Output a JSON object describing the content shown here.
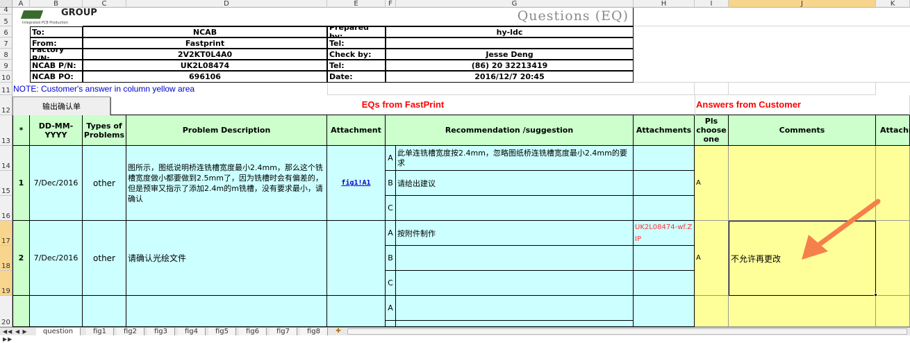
{
  "columns": [
    "A",
    "B",
    "C",
    "D",
    "E",
    "F",
    "G",
    "H",
    "I",
    "J",
    "K"
  ],
  "rows": [
    "4",
    "5",
    "6",
    "7",
    "8",
    "9",
    "10",
    "11",
    "12",
    "13",
    "14",
    "15",
    "16",
    "17",
    "18",
    "19",
    "20"
  ],
  "logo": {
    "text": "GROUP",
    "subtitle": "Integrated PCB Production"
  },
  "title": "Questions (EQ)",
  "info": {
    "to_label": "To:",
    "to_value": "NCAB",
    "from_label": "From:",
    "from_value": "Fastprint",
    "factory_label": "Factory P/N:",
    "factory_value": "2V2KT0L4A0",
    "ncab_pn_label": "NCAB P/N:",
    "ncab_pn_value": "UK2L08474",
    "ncab_po_label": "NCAB PO:",
    "ncab_po_value": "696106",
    "prepared_label": "Prepared by:",
    "prepared_value": "hy-ldc",
    "tel1_label": "Tel:",
    "tel1_value": "",
    "check_label": "Check by:",
    "check_value": "Jesse Deng",
    "tel2_label": "Tel:",
    "tel2_value": "(86) 20 32213419",
    "date_label": "Date:",
    "date_value": "2016/12/7 20:45"
  },
  "note": "NOTE: Customer's  answer in column yellow area",
  "export_button": "输出确认单",
  "eqs_title": "EQs from FastPrint",
  "answers_title": "Answers from Customer",
  "headers": {
    "star": "*",
    "date": "DD-MM-YYYY",
    "types": "Types of Problems",
    "problem": "Problem Description",
    "attachment": "Attachment",
    "recommendation": "Recommendation /suggestion",
    "attachments": "Attachments",
    "choose": "Pls choose one",
    "comments": "Comments",
    "attach_cut": "Attachn"
  },
  "eqs": [
    {
      "no": "1",
      "date": "7/Dec/2016",
      "type": "other",
      "problem": "图所示，图纸说明桥连铣槽宽度最小2.4mm，那么这个铣槽宽度做小都要做到2.5mm了，因为铣槽时会有偏差的，但是预审又指示了添加2.4m的m铣槽，没有要求最小，请确认",
      "attachment": "fig1!A1",
      "options": [
        {
          "letter": "A",
          "text": "此单连铣槽宽度按2.4mm，忽略图纸桥连铣槽宽度最小2.4mm的要求"
        },
        {
          "letter": "B",
          "text": "请给出建议"
        },
        {
          "letter": "C",
          "text": ""
        }
      ],
      "attach_file": "",
      "choice": "A",
      "comment": ""
    },
    {
      "no": "2",
      "date": "7/Dec/2016",
      "type": "other",
      "problem": "请确认光绘文件",
      "attachment": "",
      "options": [
        {
          "letter": "A",
          "text": "按附件制作"
        },
        {
          "letter": "B",
          "text": ""
        },
        {
          "letter": "C",
          "text": ""
        }
      ],
      "attach_file": "UK2L08474-wf.ZIP",
      "choice": "A",
      "comment": "不允许再更改"
    },
    {
      "no": "",
      "date": "",
      "type": "",
      "problem": "",
      "attachment": "",
      "options": [
        {
          "letter": "A",
          "text": ""
        }
      ],
      "attach_file": "",
      "choice": "",
      "comment": ""
    }
  ],
  "sheet_tabs": [
    "question",
    "fig1",
    "fig2",
    "fig3",
    "fig4",
    "fig5",
    "fig6",
    "fig7",
    "fig8"
  ],
  "colors": {
    "green": "#ccffcc",
    "cyan": "#ccffff",
    "yellow": "#ffff99",
    "red": "#ff0000",
    "arrow": "#f5804b"
  }
}
